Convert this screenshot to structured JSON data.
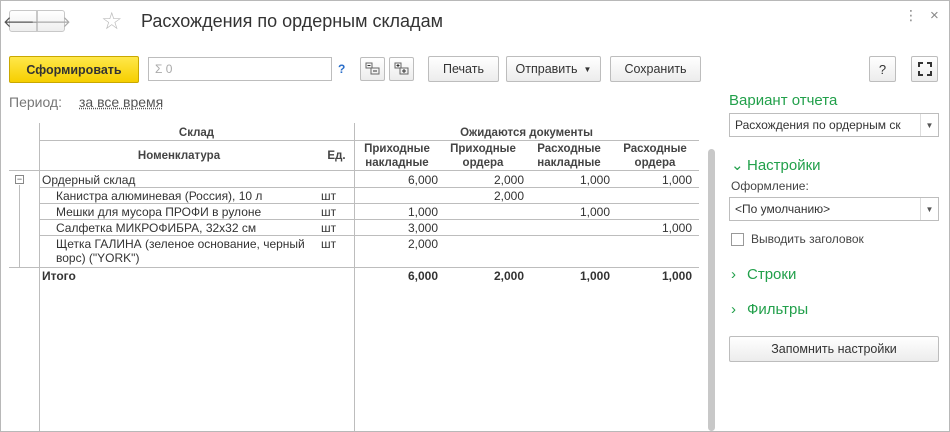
{
  "window": {
    "title": "Расхождения по ордерным складам",
    "menu_icon": "⋮",
    "close_icon": "×"
  },
  "nav": {
    "back_icon": "arrow-left-icon",
    "forward_icon": "arrow-right-icon",
    "favorite_icon": "star-icon"
  },
  "toolbar": {
    "generate_label": "Сформировать",
    "sum_placeholder": "Σ 0",
    "help_label": "?",
    "print_label": "Печать",
    "send_label": "Отправить",
    "save_label": "Сохранить",
    "help_button_label": "?",
    "expand_icon": "fullscreen-icon"
  },
  "period": {
    "label": "Период:",
    "value": "за все время"
  },
  "table": {
    "group_header": "Склад",
    "item_header": "Номенклатура",
    "unit_header": "Ед.",
    "expected_header": "Ожидаются документы",
    "columns": [
      "Приходные накладные",
      "Приходные ордера",
      "Расходные накладные",
      "Расходные ордера"
    ],
    "group": {
      "name": "Ордерный склад",
      "values": [
        "6,000",
        "2,000",
        "1,000",
        "1,000"
      ]
    },
    "rows": [
      {
        "name": "Канистра алюминевая (Россия), 10 л",
        "unit": "шт",
        "values": [
          "",
          "2,000",
          "",
          ""
        ]
      },
      {
        "name": "Мешки для мусора ПРОФИ в рулоне",
        "unit": "шт",
        "values": [
          "1,000",
          "",
          "1,000",
          ""
        ]
      },
      {
        "name": "Салфетка МИКРОФИБРА, 32х32 см",
        "unit": "шт",
        "values": [
          "3,000",
          "",
          "",
          "1,000"
        ]
      },
      {
        "name": "Щетка ГАЛИНА (зеленое основание, черный",
        "name2": "ворс) (\"YORK\")",
        "unit": "шт",
        "values": [
          "2,000",
          "",
          "",
          ""
        ]
      }
    ],
    "total": {
      "label": "Итого",
      "values": [
        "6,000",
        "2,000",
        "1,000",
        "1,000"
      ]
    }
  },
  "panel": {
    "variant_title": "Вариант отчета",
    "variant_value": "Расхождения по ордерным ск",
    "settings_title": "Настройки",
    "design_label": "Оформление:",
    "design_value": "<По умолчанию>",
    "show_header_label": "Выводить заголовок",
    "rows_title": "Строки",
    "filters_title": "Фильтры",
    "save_settings_label": "Запомнить настройки"
  }
}
